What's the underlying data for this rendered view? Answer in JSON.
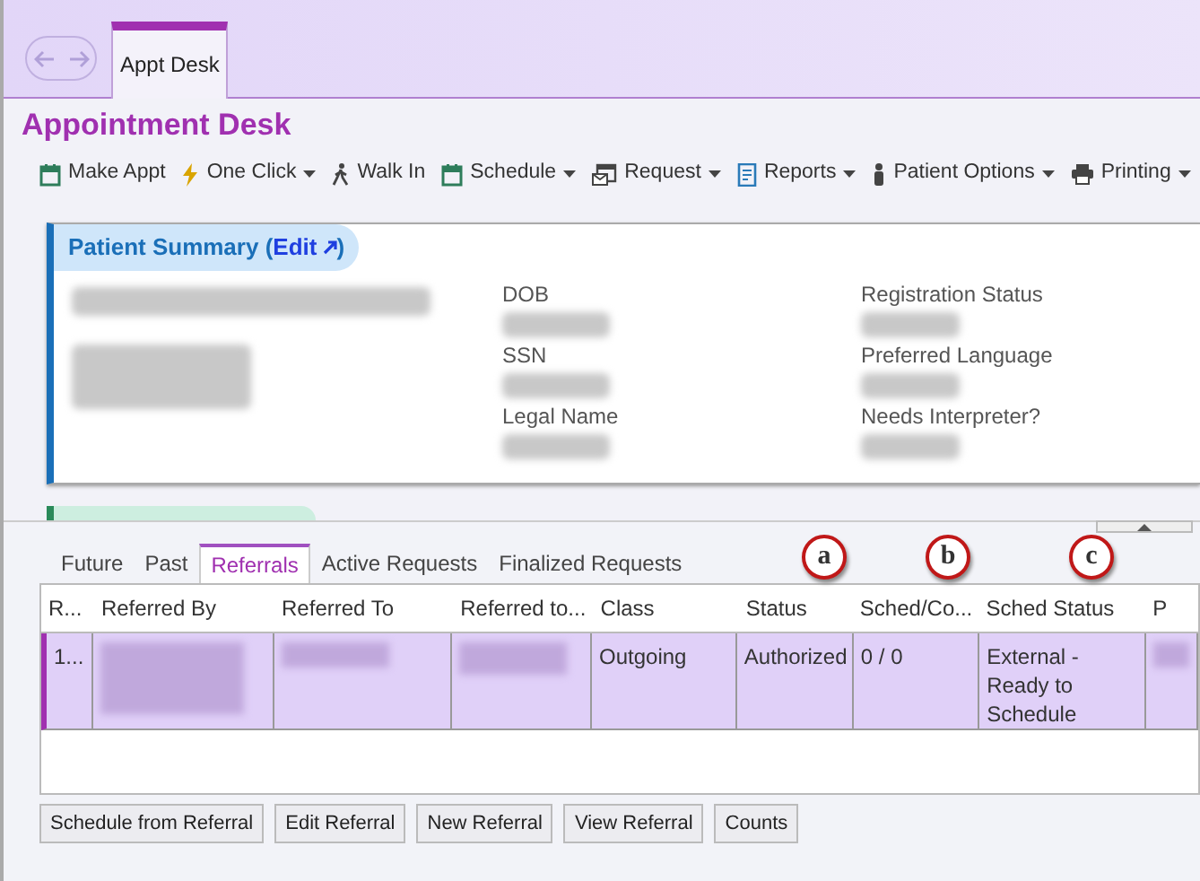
{
  "tabs": [
    {
      "label": "Appt Desk",
      "selected": true
    }
  ],
  "page_title": "Appointment Desk",
  "toolbar": [
    {
      "label": "Make Appt",
      "kind": "calendar",
      "dropdown": false
    },
    {
      "label": "One Click",
      "kind": "bolt",
      "dropdown": true
    },
    {
      "label": "Walk In",
      "kind": "walk",
      "dropdown": false
    },
    {
      "label": "Schedule",
      "kind": "calendar",
      "dropdown": true
    },
    {
      "label": "Request",
      "kind": "mail",
      "dropdown": true
    },
    {
      "label": "Reports",
      "kind": "report",
      "dropdown": true
    },
    {
      "label": "Patient Options",
      "kind": "person",
      "dropdown": true
    },
    {
      "label": "Printing",
      "kind": "printer",
      "dropdown": true
    }
  ],
  "patient_summary": {
    "title": "Patient Summary (",
    "edit_link": "Edit",
    "title_end": ")",
    "fields": [
      {
        "label": "DOB"
      },
      {
        "label": "SSN"
      },
      {
        "label": "Legal Name"
      },
      {
        "label": "Registration Status"
      },
      {
        "label": "Preferred Language"
      },
      {
        "label": "Needs Interpreter?"
      }
    ]
  },
  "lower_tabs": [
    {
      "label": "Future",
      "selected": false
    },
    {
      "label": "Past",
      "selected": false
    },
    {
      "label": "Referrals",
      "selected": true
    },
    {
      "label": "Active Requests",
      "selected": false
    },
    {
      "label": "Finalized Requests",
      "selected": false
    }
  ],
  "annotations": [
    "a",
    "b",
    "c"
  ],
  "table": {
    "columns": [
      "R...",
      "Referred By",
      "Referred To",
      "Referred to...",
      "Class",
      "Status",
      "Sched/Co...",
      "Sched Status",
      "P"
    ],
    "rows": [
      {
        "selected": true,
        "cells": [
          "1...",
          "",
          "",
          "",
          "Outgoing",
          "Authorized",
          "0 / 0",
          "External - Ready to Schedule",
          ""
        ]
      }
    ]
  },
  "buttons": [
    "Schedule from Referral",
    "Edit Referral",
    "New Referral",
    "View Referral",
    "Counts"
  ]
}
